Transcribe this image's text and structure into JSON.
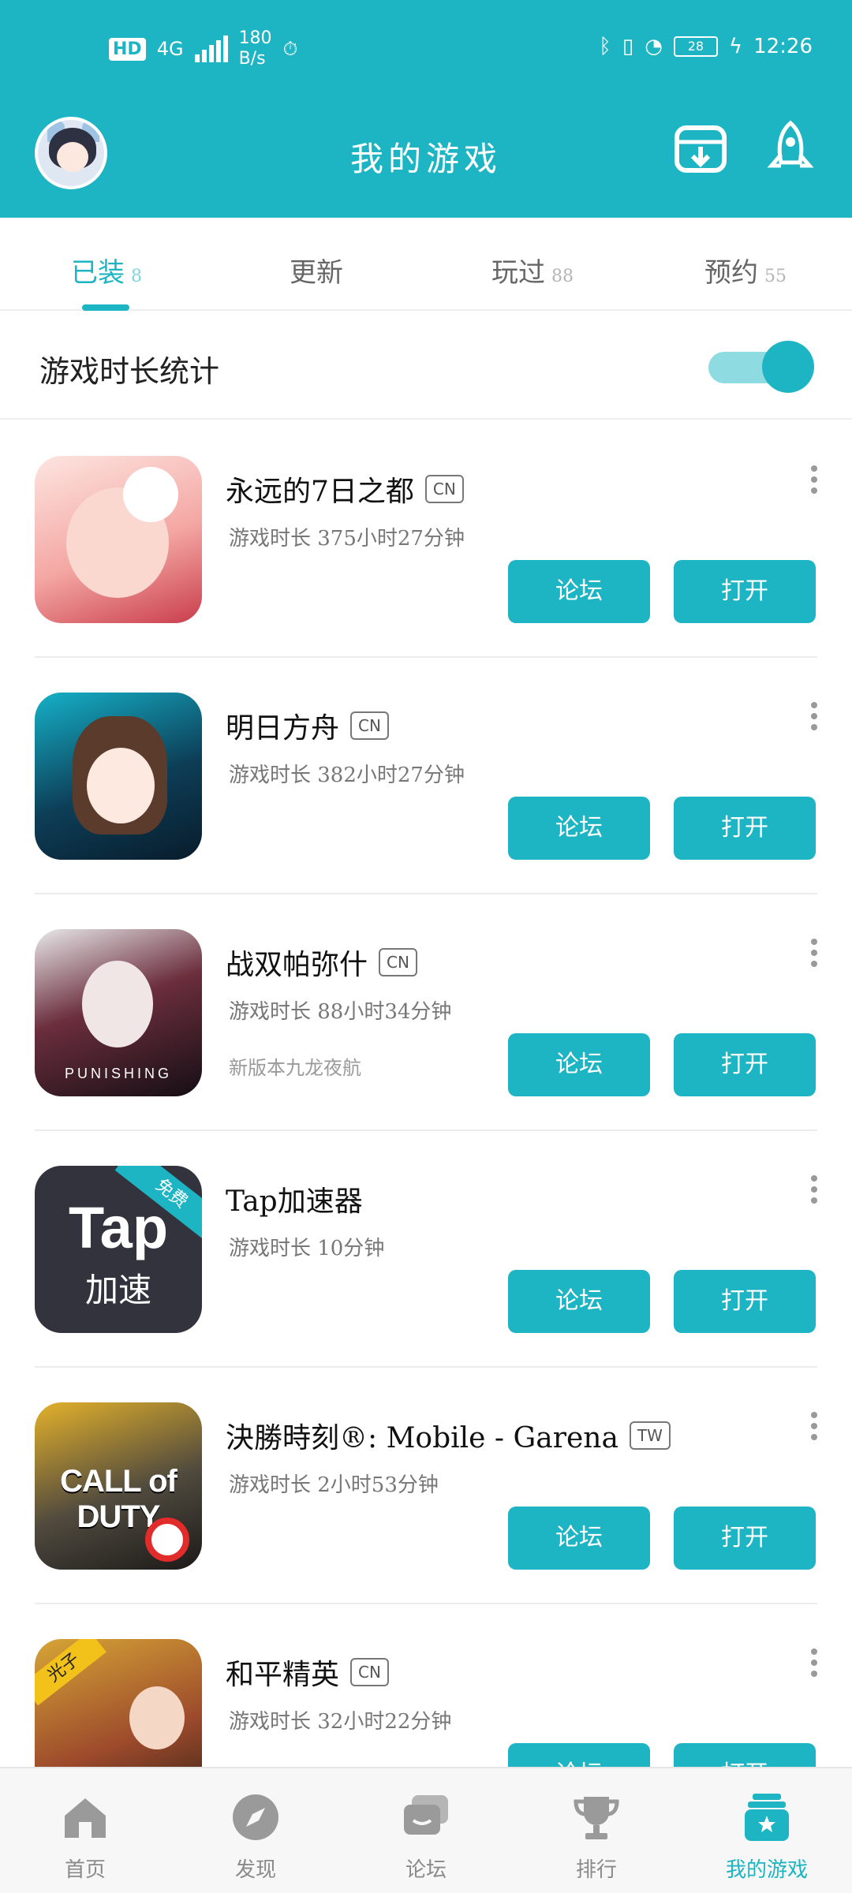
{
  "status_bar": {
    "hd": "HD",
    "network": "4G",
    "speed_value": "180",
    "speed_unit": "B/s",
    "battery": "28",
    "time": "12:26"
  },
  "header": {
    "title": "我的游戏",
    "avatar_icon": "avatar-anime",
    "download_icon": "download-box-icon",
    "rocket_icon": "rocket-icon"
  },
  "tabs": [
    {
      "label": "已装",
      "count": "8",
      "active": true
    },
    {
      "label": "更新",
      "count": "",
      "active": false
    },
    {
      "label": "玩过",
      "count": "88",
      "active": false
    },
    {
      "label": "预约",
      "count": "55",
      "active": false
    }
  ],
  "stats": {
    "label": "游戏时长统计",
    "toggle_on": true
  },
  "games": [
    {
      "name": "永远的7日之都",
      "region": "CN",
      "time": "游戏时长 375小时27分钟",
      "sub": "",
      "forum": "论坛",
      "open": "打开"
    },
    {
      "name": "明日方舟",
      "region": "CN",
      "time": "游戏时长 382小时27分钟",
      "sub": "",
      "forum": "论坛",
      "open": "打开"
    },
    {
      "name": "战双帕弥什",
      "region": "CN",
      "time": "游戏时长 88小时34分钟",
      "sub": "新版本九龙夜航",
      "forum": "论坛",
      "open": "打开",
      "icon_caption": "PUNISHING"
    },
    {
      "name": "Tap加速器",
      "region": "",
      "time": "游戏时长 10分钟",
      "sub": "",
      "forum": "论坛",
      "open": "打开",
      "icon_title": "Tap",
      "icon_sub": "加速",
      "icon_ribbon": "免费"
    },
    {
      "name": "決勝時刻®: Mobile - Garena",
      "region": "TW",
      "time": "游戏时长 2小时53分钟",
      "sub": "",
      "forum": "论坛",
      "open": "打开",
      "icon_title": "CALL of DUTY"
    },
    {
      "name": "和平精英",
      "region": "CN",
      "time": "游戏时长 32小时22分钟",
      "sub": "",
      "forum": "论坛",
      "open": "打开",
      "icon_ribbon": "光子"
    }
  ],
  "bottom_nav": [
    {
      "label": "首页",
      "icon": "home-icon",
      "active": false
    },
    {
      "label": "发现",
      "icon": "compass-icon",
      "active": false
    },
    {
      "label": "论坛",
      "icon": "chat-bubbles-icon",
      "active": false
    },
    {
      "label": "排行",
      "icon": "trophy-icon",
      "active": false
    },
    {
      "label": "我的游戏",
      "icon": "star-box-icon",
      "active": true
    }
  ],
  "colors": {
    "accent": "#1db5c3",
    "accent_light": "#8fdbe2",
    "nav_bg": "#f7f7f7"
  }
}
